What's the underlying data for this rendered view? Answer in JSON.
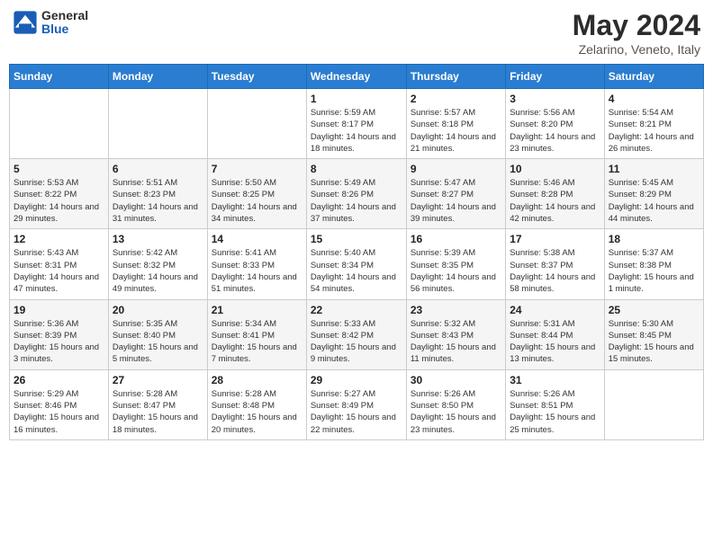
{
  "logo": {
    "text_general": "General",
    "text_blue": "Blue"
  },
  "header": {
    "month_year": "May 2024",
    "location": "Zelarino, Veneto, Italy"
  },
  "weekdays": [
    "Sunday",
    "Monday",
    "Tuesday",
    "Wednesday",
    "Thursday",
    "Friday",
    "Saturday"
  ],
  "weeks": [
    [
      {
        "day": "",
        "sunrise": "",
        "sunset": "",
        "daylight": ""
      },
      {
        "day": "",
        "sunrise": "",
        "sunset": "",
        "daylight": ""
      },
      {
        "day": "",
        "sunrise": "",
        "sunset": "",
        "daylight": ""
      },
      {
        "day": "1",
        "sunrise": "Sunrise: 5:59 AM",
        "sunset": "Sunset: 8:17 PM",
        "daylight": "Daylight: 14 hours and 18 minutes."
      },
      {
        "day": "2",
        "sunrise": "Sunrise: 5:57 AM",
        "sunset": "Sunset: 8:18 PM",
        "daylight": "Daylight: 14 hours and 21 minutes."
      },
      {
        "day": "3",
        "sunrise": "Sunrise: 5:56 AM",
        "sunset": "Sunset: 8:20 PM",
        "daylight": "Daylight: 14 hours and 23 minutes."
      },
      {
        "day": "4",
        "sunrise": "Sunrise: 5:54 AM",
        "sunset": "Sunset: 8:21 PM",
        "daylight": "Daylight: 14 hours and 26 minutes."
      }
    ],
    [
      {
        "day": "5",
        "sunrise": "Sunrise: 5:53 AM",
        "sunset": "Sunset: 8:22 PM",
        "daylight": "Daylight: 14 hours and 29 minutes."
      },
      {
        "day": "6",
        "sunrise": "Sunrise: 5:51 AM",
        "sunset": "Sunset: 8:23 PM",
        "daylight": "Daylight: 14 hours and 31 minutes."
      },
      {
        "day": "7",
        "sunrise": "Sunrise: 5:50 AM",
        "sunset": "Sunset: 8:25 PM",
        "daylight": "Daylight: 14 hours and 34 minutes."
      },
      {
        "day": "8",
        "sunrise": "Sunrise: 5:49 AM",
        "sunset": "Sunset: 8:26 PM",
        "daylight": "Daylight: 14 hours and 37 minutes."
      },
      {
        "day": "9",
        "sunrise": "Sunrise: 5:47 AM",
        "sunset": "Sunset: 8:27 PM",
        "daylight": "Daylight: 14 hours and 39 minutes."
      },
      {
        "day": "10",
        "sunrise": "Sunrise: 5:46 AM",
        "sunset": "Sunset: 8:28 PM",
        "daylight": "Daylight: 14 hours and 42 minutes."
      },
      {
        "day": "11",
        "sunrise": "Sunrise: 5:45 AM",
        "sunset": "Sunset: 8:29 PM",
        "daylight": "Daylight: 14 hours and 44 minutes."
      }
    ],
    [
      {
        "day": "12",
        "sunrise": "Sunrise: 5:43 AM",
        "sunset": "Sunset: 8:31 PM",
        "daylight": "Daylight: 14 hours and 47 minutes."
      },
      {
        "day": "13",
        "sunrise": "Sunrise: 5:42 AM",
        "sunset": "Sunset: 8:32 PM",
        "daylight": "Daylight: 14 hours and 49 minutes."
      },
      {
        "day": "14",
        "sunrise": "Sunrise: 5:41 AM",
        "sunset": "Sunset: 8:33 PM",
        "daylight": "Daylight: 14 hours and 51 minutes."
      },
      {
        "day": "15",
        "sunrise": "Sunrise: 5:40 AM",
        "sunset": "Sunset: 8:34 PM",
        "daylight": "Daylight: 14 hours and 54 minutes."
      },
      {
        "day": "16",
        "sunrise": "Sunrise: 5:39 AM",
        "sunset": "Sunset: 8:35 PM",
        "daylight": "Daylight: 14 hours and 56 minutes."
      },
      {
        "day": "17",
        "sunrise": "Sunrise: 5:38 AM",
        "sunset": "Sunset: 8:37 PM",
        "daylight": "Daylight: 14 hours and 58 minutes."
      },
      {
        "day": "18",
        "sunrise": "Sunrise: 5:37 AM",
        "sunset": "Sunset: 8:38 PM",
        "daylight": "Daylight: 15 hours and 1 minute."
      }
    ],
    [
      {
        "day": "19",
        "sunrise": "Sunrise: 5:36 AM",
        "sunset": "Sunset: 8:39 PM",
        "daylight": "Daylight: 15 hours and 3 minutes."
      },
      {
        "day": "20",
        "sunrise": "Sunrise: 5:35 AM",
        "sunset": "Sunset: 8:40 PM",
        "daylight": "Daylight: 15 hours and 5 minutes."
      },
      {
        "day": "21",
        "sunrise": "Sunrise: 5:34 AM",
        "sunset": "Sunset: 8:41 PM",
        "daylight": "Daylight: 15 hours and 7 minutes."
      },
      {
        "day": "22",
        "sunrise": "Sunrise: 5:33 AM",
        "sunset": "Sunset: 8:42 PM",
        "daylight": "Daylight: 15 hours and 9 minutes."
      },
      {
        "day": "23",
        "sunrise": "Sunrise: 5:32 AM",
        "sunset": "Sunset: 8:43 PM",
        "daylight": "Daylight: 15 hours and 11 minutes."
      },
      {
        "day": "24",
        "sunrise": "Sunrise: 5:31 AM",
        "sunset": "Sunset: 8:44 PM",
        "daylight": "Daylight: 15 hours and 13 minutes."
      },
      {
        "day": "25",
        "sunrise": "Sunrise: 5:30 AM",
        "sunset": "Sunset: 8:45 PM",
        "daylight": "Daylight: 15 hours and 15 minutes."
      }
    ],
    [
      {
        "day": "26",
        "sunrise": "Sunrise: 5:29 AM",
        "sunset": "Sunset: 8:46 PM",
        "daylight": "Daylight: 15 hours and 16 minutes."
      },
      {
        "day": "27",
        "sunrise": "Sunrise: 5:28 AM",
        "sunset": "Sunset: 8:47 PM",
        "daylight": "Daylight: 15 hours and 18 minutes."
      },
      {
        "day": "28",
        "sunrise": "Sunrise: 5:28 AM",
        "sunset": "Sunset: 8:48 PM",
        "daylight": "Daylight: 15 hours and 20 minutes."
      },
      {
        "day": "29",
        "sunrise": "Sunrise: 5:27 AM",
        "sunset": "Sunset: 8:49 PM",
        "daylight": "Daylight: 15 hours and 22 minutes."
      },
      {
        "day": "30",
        "sunrise": "Sunrise: 5:26 AM",
        "sunset": "Sunset: 8:50 PM",
        "daylight": "Daylight: 15 hours and 23 minutes."
      },
      {
        "day": "31",
        "sunrise": "Sunrise: 5:26 AM",
        "sunset": "Sunset: 8:51 PM",
        "daylight": "Daylight: 15 hours and 25 minutes."
      },
      {
        "day": "",
        "sunrise": "",
        "sunset": "",
        "daylight": ""
      }
    ]
  ]
}
